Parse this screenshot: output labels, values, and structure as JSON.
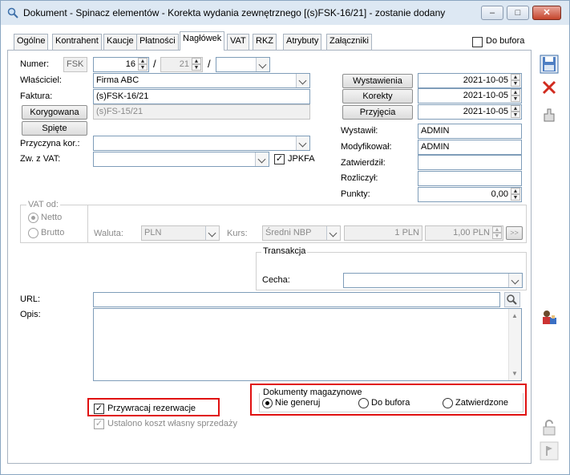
{
  "window": {
    "title": "Dokument - Spinacz elementów - Korekta wydania zewnętrznego [(s)FSK-16/21] - zostanie dodany",
    "minimize": "–",
    "maximize": "□",
    "close": "✕"
  },
  "tabs": [
    "Ogólne",
    "Kontrahent",
    "Kaucje",
    "Płatności",
    "Nagłówek",
    "VAT",
    "RKZ",
    "Atrybuty",
    "Załączniki"
  ],
  "do_bufora": {
    "label": "Do bufora",
    "checked": false
  },
  "form": {
    "numer_label": "Numer:",
    "numer_prefix": "FSK",
    "numer_value": "16",
    "numer_year": "21",
    "slash": "/",
    "wlasciciel_label": "Właściciel:",
    "wlasciciel_value": "Firma ABC",
    "faktura_label": "Faktura:",
    "faktura_value": "(s)FSK-16/21",
    "korygowana_button": "Korygowana",
    "korygowana_value": "(s)FS-15/21",
    "spiete_button": "Spięte",
    "przyczyna_label": "Przyczyna kor.:",
    "przyczyna_value": "",
    "zw_vat_label": "Zw. z VAT:",
    "zw_vat_value": "",
    "jpkfa_label": "JPKFA",
    "jpkfa_checked": true
  },
  "dates": {
    "wystawienia_button": "Wystawienia",
    "wystawienia_value": "2021-10-05",
    "korekty_button": "Korekty",
    "korekty_value": "2021-10-05",
    "przyjecia_button": "Przyjęcia",
    "przyjecia_value": "2021-10-05"
  },
  "people": {
    "wystawil_label": "Wystawił:",
    "wystawil_value": "ADMIN",
    "modyfikowal_label": "Modyfikował:",
    "modyfikowal_value": "ADMIN",
    "zatwierdzil_label": "Zatwierdził:",
    "zatwierdzil_value": "",
    "rozliczyl_label": "Rozliczył:",
    "rozliczyl_value": "",
    "punkty_label": "Punkty:",
    "punkty_value": "0,00"
  },
  "vat_od": {
    "title": "VAT od:",
    "netto": "Netto",
    "brutto": "Brutto",
    "selected": "Netto"
  },
  "currency": {
    "waluta_label": "Waluta:",
    "waluta_value": "PLN",
    "kurs_label": "Kurs:",
    "kurs_value": "Średni NBP",
    "rate_left": "1 PLN",
    "rate_right": "1,00 PLN",
    "more": ">>"
  },
  "transakcja": {
    "title": "Transakcja",
    "cecha_label": "Cecha:",
    "cecha_value": ""
  },
  "url": {
    "label": "URL:",
    "value": ""
  },
  "opis": {
    "label": "Opis:",
    "value": ""
  },
  "przywracaj": {
    "label": "Przywracaj rezerwacje",
    "checked": true
  },
  "ustalono": {
    "label": "Ustalono koszt własny sprzedaży",
    "checked": true
  },
  "dokumenty_magazynowe": {
    "title": "Dokumenty magazynowe",
    "options": [
      "Nie generuj",
      "Do bufora",
      "Zatwierdzone"
    ],
    "selected": "Nie generuj"
  },
  "colors": {
    "highlight_box": "#e01010",
    "title_bar": "#dde8f3"
  }
}
